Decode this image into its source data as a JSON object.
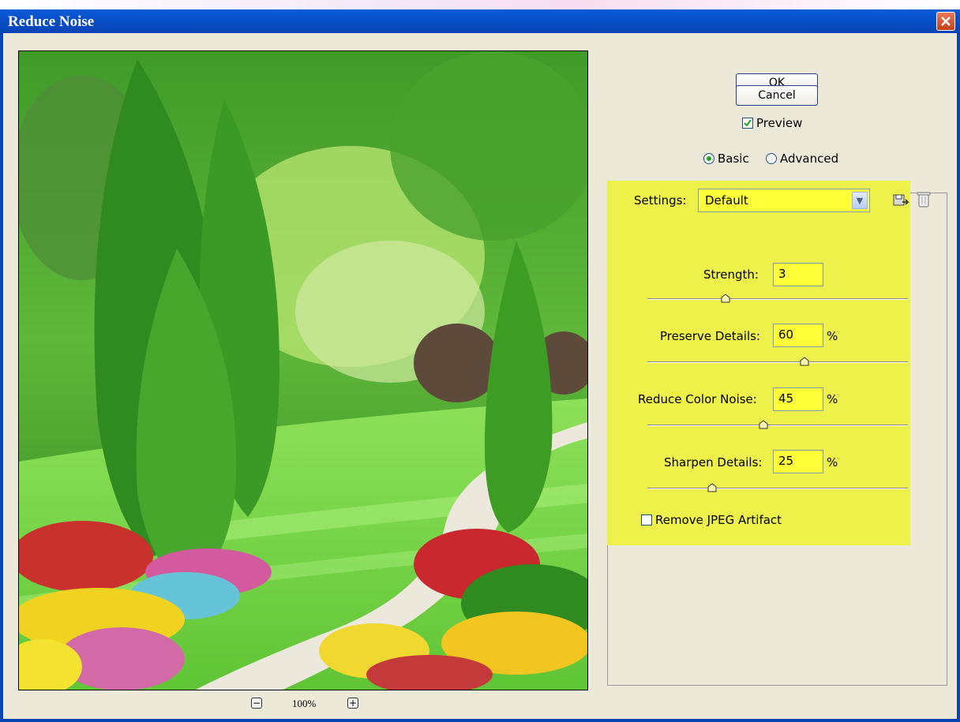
{
  "window": {
    "title": "Reduce Noise"
  },
  "preview": {
    "zoom": "100%",
    "zoom_out_symbol": "−",
    "zoom_in_symbol": "+"
  },
  "buttons": {
    "ok": "OK",
    "cancel": "Cancel"
  },
  "preview_checkbox": {
    "label": "Preview",
    "checked": true
  },
  "mode": {
    "basic": "Basic",
    "advanced": "Advanced",
    "selected": "basic"
  },
  "settings": {
    "label": "Settings:",
    "value": "Default"
  },
  "controls": {
    "strength": {
      "label": "Strength:",
      "value": "3",
      "unit": "",
      "slider_fraction": 0.3
    },
    "preserve_details": {
      "label": "Preserve Details:",
      "value": "60",
      "unit": "%",
      "slider_fraction": 0.6
    },
    "reduce_color_noise": {
      "label": "Reduce Color Noise:",
      "value": "45",
      "unit": "%",
      "slider_fraction": 0.45
    },
    "sharpen_details": {
      "label": "Sharpen Details:",
      "value": "25",
      "unit": "%",
      "slider_fraction": 0.25
    }
  },
  "jpeg_checkbox": {
    "label": "Remove JPEG Artifact",
    "checked": false
  },
  "colors": {
    "highlight": "#eef14a",
    "field": "#ffff3a",
    "titlebar": "#0850c8"
  }
}
